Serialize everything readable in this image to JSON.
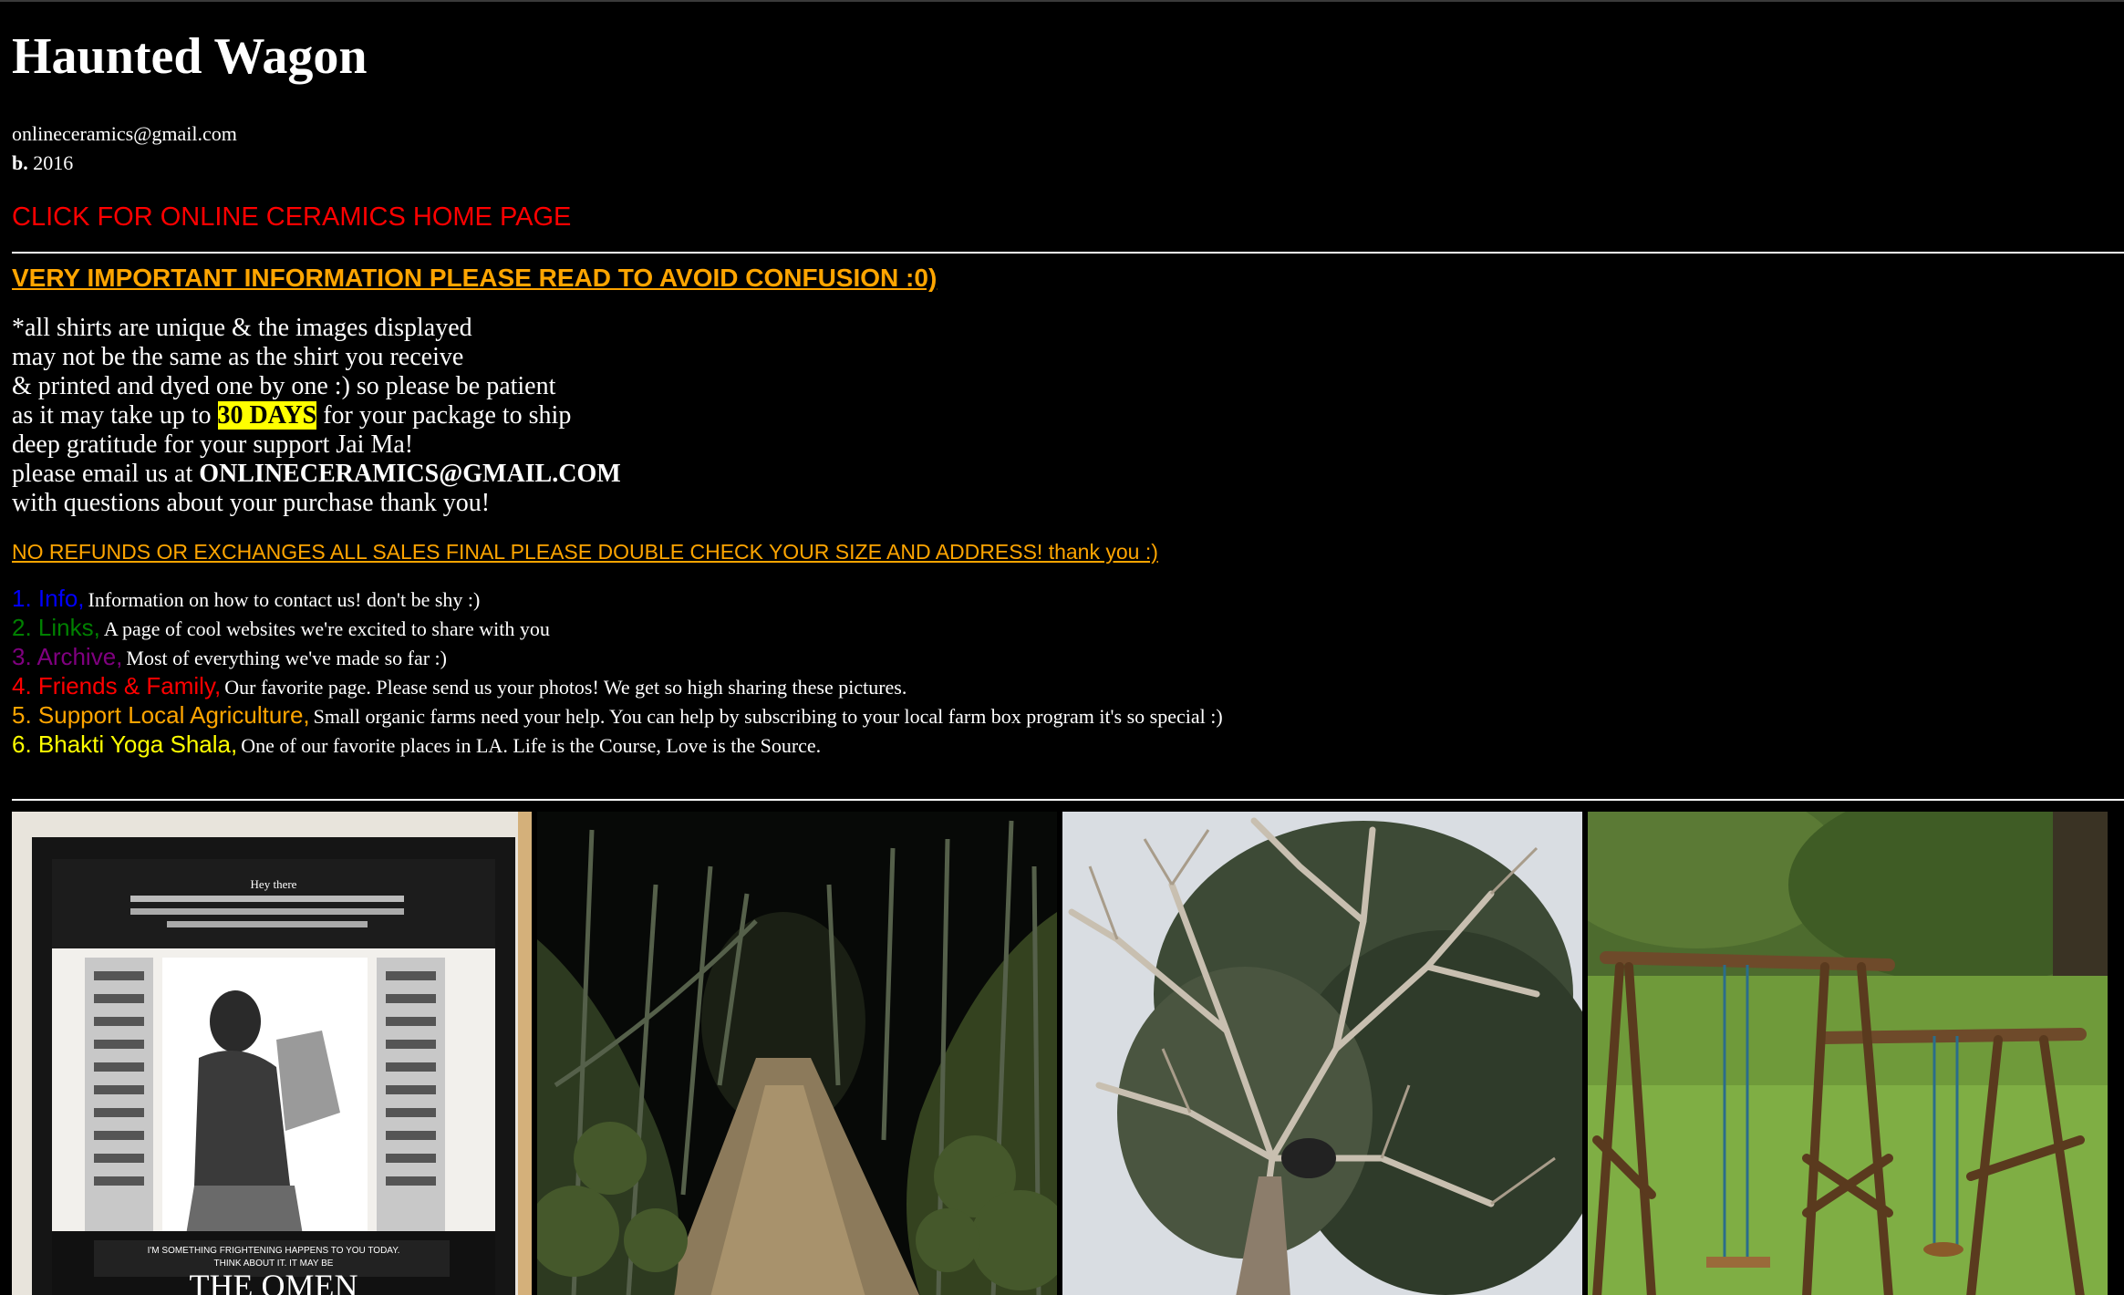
{
  "site": {
    "title": "Haunted Wagon",
    "email": "onlineceramics@gmail.com",
    "born_label": "b.",
    "born_year": "2016",
    "home_link": "CLICK FOR ONLINE CERAMICS HOME PAGE"
  },
  "notice": {
    "heading": "VERY IMPORTANT INFORMATION PLEASE READ TO AVOID CONFUSION :0)",
    "line1": "*all shirts are unique & the images displayed",
    "line2": "may not be the same as the shirt you receive",
    "line3": "& printed and dyed one by one :) so please be patient",
    "line4_before": "as it may take up to ",
    "line4_highlight": "30 DAYS",
    "line4_after": " for your package to ship",
    "line5": "deep gratitude for your support Jai Ma!",
    "line6_before": "please email us at ",
    "line6_email": "ONLINECERAMICS@GMAIL.COM",
    "line7": "with questions about your purchase thank you!",
    "refund": "NO REFUNDS OR EXCHANGES ALL SALES FINAL PLEASE DOUBLE CHECK YOUR SIZE AND ADDRESS! thank you :)"
  },
  "nav": [
    {
      "label": "1. Info,",
      "description": "Information on how to contact us! don't be shy :)",
      "color": "#0000ff"
    },
    {
      "label": "2. Links,",
      "description": "A page of cool websites we're excited to share with you",
      "color": "#008000"
    },
    {
      "label": "3. Archive,",
      "description": "Most of everything we've made so far :)",
      "color": "#800080"
    },
    {
      "label": "4. Friends & Family,",
      "description": "Our favorite page. Please send us your photos! We get so high sharing these pictures.",
      "color": "#ff0000"
    },
    {
      "label": "5. Support Local Agriculture,",
      "description": "Small organic farms need your help. You can help by subscribing to your local farm box program it's so special :)",
      "color": "#ffa500"
    },
    {
      "label": "6. Bhakti Yoga Shala,",
      "description": "One of our favorite places in LA. Life is the Course, Love is the Source.",
      "color": "#ffff00"
    }
  ],
  "gallery": {
    "painting_text_top": "Hey there",
    "painting_text_mid": "I'M SOMETHING FRIGHTENING HAPPENS TO YOU TODAY.",
    "painting_text_mid2": "THINK ABOUT IT. IT MAY BE",
    "painting_title": "THE OMEN"
  },
  "colors": {
    "background": "#000000",
    "text": "#ffffff",
    "home_link": "#ff0000",
    "warning": "#ffa500",
    "highlight": "#ffff00"
  }
}
